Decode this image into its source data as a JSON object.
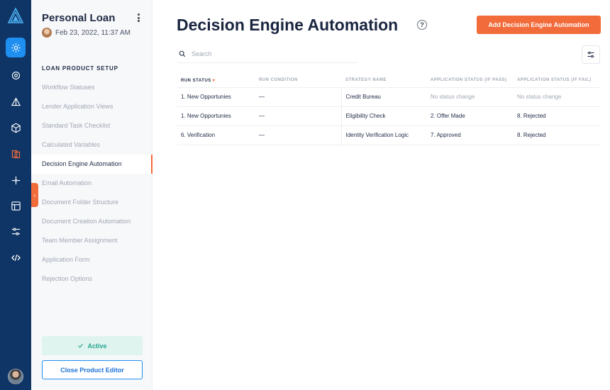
{
  "rail": {
    "icons": [
      "logo-icon",
      "gear-icon",
      "settings-cog-icon",
      "pie-chart-icon",
      "cube-icon",
      "book-icon",
      "network-icon",
      "layout-icon",
      "sliders-icon",
      "code-icon"
    ]
  },
  "sidebar": {
    "title": "Personal Loan",
    "timestamp": "Feb 23, 2022, 11:37 AM",
    "section_label": "LOAN PRODUCT SETUP",
    "items": [
      {
        "label": "Workflow Statuses"
      },
      {
        "label": "Lender Application Views"
      },
      {
        "label": "Standard Task Checklist"
      },
      {
        "label": "Calculated Variables"
      },
      {
        "label": "Decision Engine Automation"
      },
      {
        "label": "Email Automation"
      },
      {
        "label": "Document Folder Structure"
      },
      {
        "label": "Document Creation Automation"
      },
      {
        "label": "Team Member Assignment"
      },
      {
        "label": "Application Form"
      },
      {
        "label": "Rejection Options"
      }
    ],
    "active_index": 4,
    "status_label": "Active",
    "close_label": "Close Product Editor"
  },
  "main": {
    "title": "Decision Engine Automation",
    "help_glyph": "?",
    "add_button": "Add Decision Engine Automation",
    "search_placeholder": "Search",
    "table": {
      "headers": [
        "RUN STATUS",
        "RUN CONDITION",
        "STRATEGY NAME",
        "APPLICATION STATUS (IF PASS)",
        "APPLICATION STATUS (IF FAIL)"
      ],
      "rows": [
        [
          "1. New Opportunies",
          "—",
          "Credit Bureau",
          "No status change",
          "No status change"
        ],
        [
          "1. New Opportunies",
          "—",
          "Eligibility Check",
          "2. Offer Made",
          "8. Rejected"
        ],
        [
          "6. Verification",
          "—",
          "Identity Verification Logic",
          "7. Approved",
          "8. Rejected"
        ]
      ]
    }
  },
  "colors": {
    "rail_bg": "#0f3566",
    "accent_blue": "#1e8ef0",
    "accent_orange": "#f26b3a",
    "active_green": "#27a68f"
  }
}
